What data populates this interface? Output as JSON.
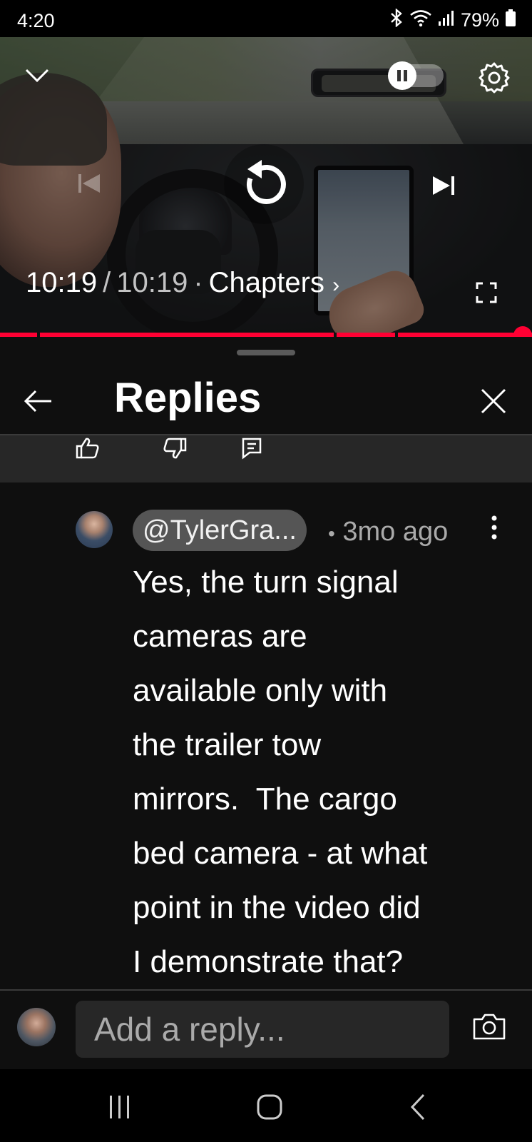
{
  "status_bar": {
    "time": "4:20",
    "battery": "79%",
    "icons": [
      "bluetooth-icon",
      "wifi-icon",
      "signal-icon",
      "battery-icon"
    ]
  },
  "player": {
    "current_time": "10:19",
    "separator": "/",
    "duration": "10:19",
    "dot": "·",
    "chapters_label": "Chapters",
    "chapters_chevron": "›",
    "progress_fraction": 1.0,
    "accent_color": "#ff0033",
    "controls": [
      "chevron-down-icon",
      "autoplay-toggle",
      "gear-icon",
      "previous-icon",
      "replay-icon",
      "next-icon",
      "fullscreen-icon"
    ]
  },
  "panel": {
    "title": "Replies",
    "parent_actions": [
      "thumbs-up-icon",
      "thumbs-down-icon",
      "reply-icon"
    ]
  },
  "reply": {
    "author": "@TylerGra...",
    "bullet": "•",
    "time_ago": "3mo ago",
    "text": "Yes, the turn signal\ncameras are\navailable only with\nthe trailer tow\nmirrors.  The cargo\nbed camera - at what\npoint in the video did\nI demonstrate that?"
  },
  "composer": {
    "placeholder": "Add a reply..."
  },
  "navbar": {
    "buttons": [
      "recents-icon",
      "home-icon",
      "back-icon"
    ]
  }
}
